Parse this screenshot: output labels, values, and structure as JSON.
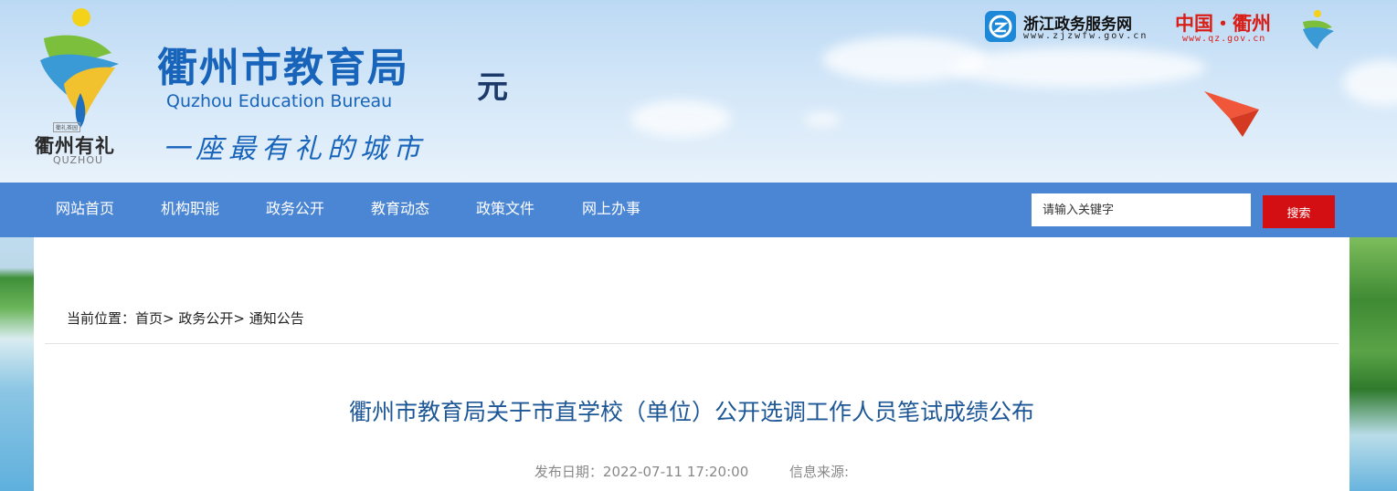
{
  "header": {
    "emblem_sub_label": "衢礼茶园",
    "emblem_main": "衢州有礼",
    "emblem_en": "QUZHOU",
    "site_title": "衢州市教育局",
    "site_title_en": "Quzhou Education Bureau",
    "slogan": "一座最有礼的城市",
    "stamp_glyph": "元",
    "zj_name": "浙江政务服务网",
    "zj_url": "www.zjzwfw.gov.cn",
    "qz_name": "中国・衢州",
    "qz_url": "www.qz.gov.cn"
  },
  "nav": {
    "items": [
      {
        "label": "网站首页"
      },
      {
        "label": "机构职能"
      },
      {
        "label": "政务公开"
      },
      {
        "label": "教育动态"
      },
      {
        "label": "政策文件"
      },
      {
        "label": "网上办事"
      }
    ],
    "search_placeholder": "请输入关键字",
    "search_button": "搜索"
  },
  "breadcrumb": {
    "prefix": "当前位置：",
    "items": [
      "首页",
      "政务公开",
      "通知公告"
    ],
    "separator": ">"
  },
  "article": {
    "title": "衢州市教育局关于市直学校（单位）公开选调工作人员笔试成绩公布",
    "date_label": "发布日期：2022-07-11 17:20:00",
    "source_label": "信息来源:"
  },
  "colors": {
    "nav_bg": "#4b86d4",
    "brand_blue": "#1764ba",
    "search_button": "#d30f14",
    "title_blue": "#1e5796"
  },
  "icons": [
    "quzhou-emblem-icon",
    "zjzwfw-logo-icon",
    "small-emblem-icon",
    "paper-plane-icon"
  ]
}
